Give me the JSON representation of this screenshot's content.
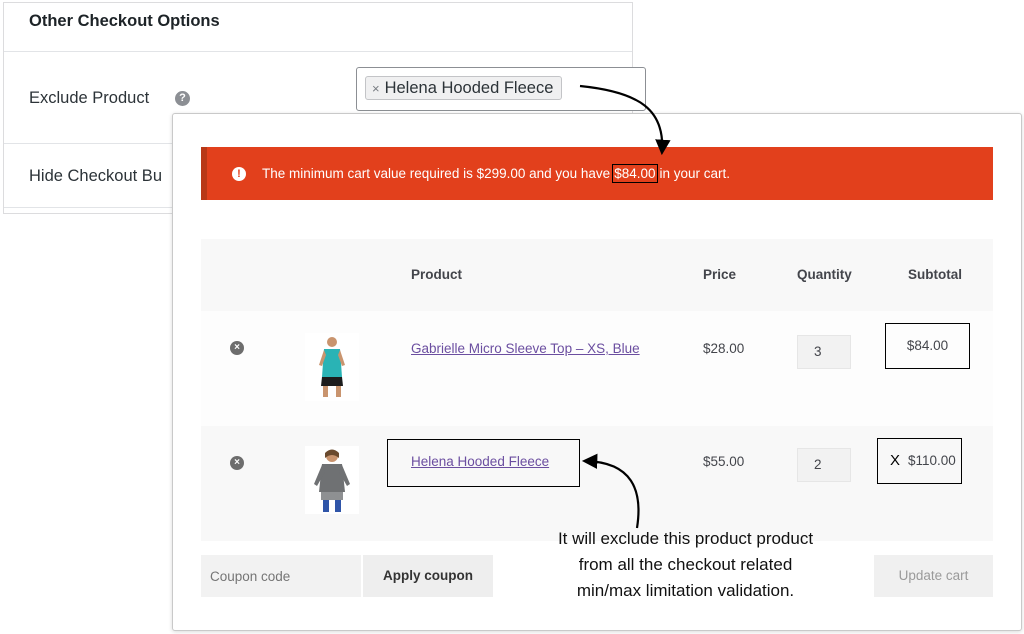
{
  "settings": {
    "title": "Other Checkout Options",
    "exclude_label": "Exclude Product",
    "help_glyph": "?",
    "selected_chip": "Helena Hooded Fleece",
    "chip_remove": "×",
    "hide_label": "Hide Checkout Bu"
  },
  "notice": {
    "icon": "!",
    "text_before": "The minimum cart value required is $299.00 and you have",
    "current_value": "$84.00",
    "text_after": "in your cart.",
    "color": "#e2401c"
  },
  "cart": {
    "headers": {
      "product": "Product",
      "price": "Price",
      "quantity": "Quantity",
      "subtotal": "Subtotal"
    },
    "items": [
      {
        "name": "Gabrielle Micro Sleeve Top – XS, Blue",
        "price": "$28.00",
        "quantity": "3",
        "subtotal": "$84.00",
        "remove": "×"
      },
      {
        "name": "Helena Hooded Fleece",
        "price": "$55.00",
        "quantity": "2",
        "subtotal": "$110.00",
        "remove": "×",
        "excluded_mark": "X"
      }
    ],
    "coupon_placeholder": "Coupon code",
    "apply_label": "Apply coupon",
    "update_label": "Update cart"
  },
  "annotation": {
    "lines": [
      "It will exclude this product product",
      "from all the checkout related",
      "min/max limitation validation."
    ]
  }
}
